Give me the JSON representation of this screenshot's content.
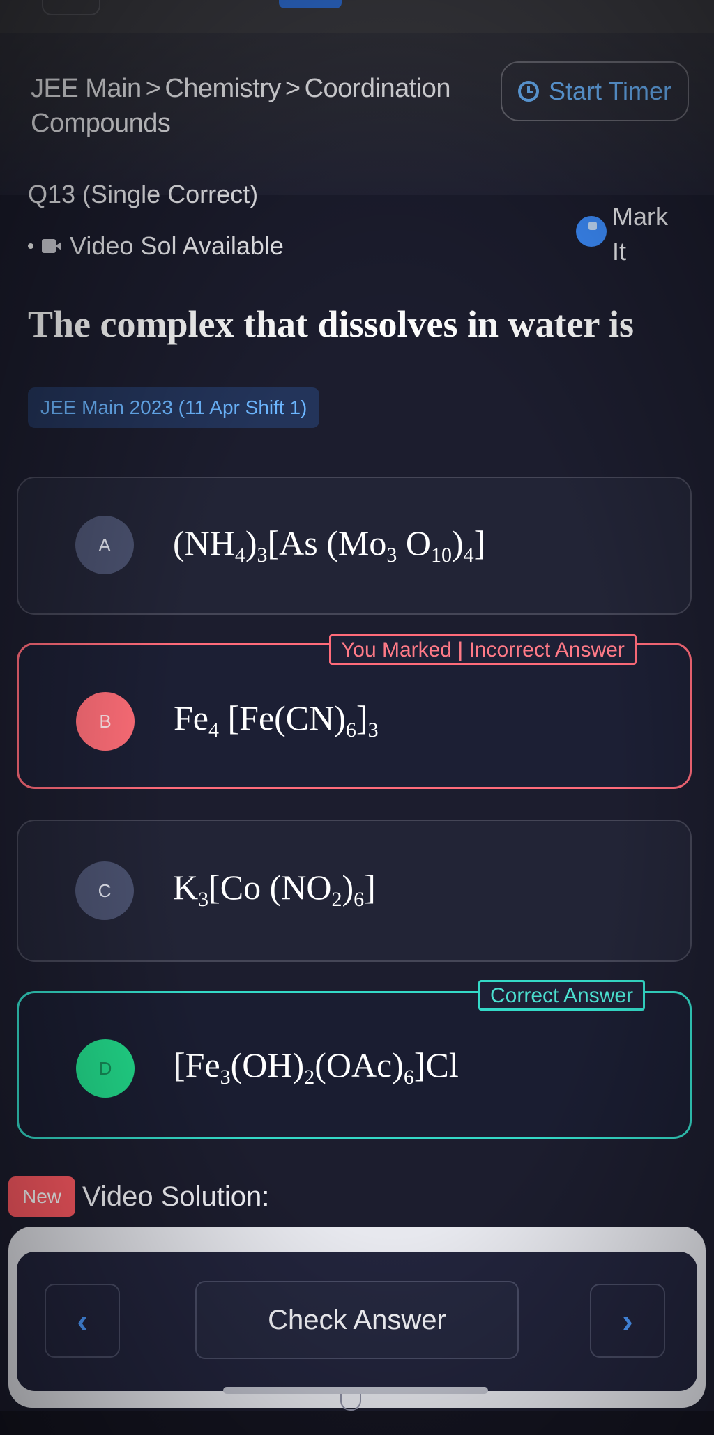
{
  "breadcrumb": {
    "exam": "JEE Main",
    "subject": "Chemistry",
    "chapter": "Coordination Compounds",
    "separator": ">"
  },
  "timer": {
    "label": "Start Timer",
    "icon": "clock-icon"
  },
  "question": {
    "label": "Q13 (Single Correct)",
    "video_note": "Video Sol Available",
    "mark_label": "Mark It",
    "text": "The complex that dissolves in water is",
    "source_tag": "JEE Main 2023 (11 Apr Shift 1)"
  },
  "options": [
    {
      "letter": "A",
      "status": "none"
    },
    {
      "letter": "B",
      "status": "marked-incorrect",
      "result_label": "You Marked | Incorrect Answer"
    },
    {
      "letter": "C",
      "status": "none"
    },
    {
      "letter": "D",
      "status": "correct",
      "result_label": "Correct Answer"
    }
  ],
  "video_solution": {
    "badge": "New",
    "label": "Video Solution:"
  },
  "footer": {
    "prev_icon": "chevron-left-icon",
    "next_icon": "chevron-right-icon",
    "check_label": "Check Answer"
  },
  "colors": {
    "accent_blue": "#6cb6ff",
    "incorrect": "#ff6b7a",
    "correct": "#34d9c7",
    "correct_badge": "#22d98a",
    "new_badge": "#ff5a63"
  }
}
